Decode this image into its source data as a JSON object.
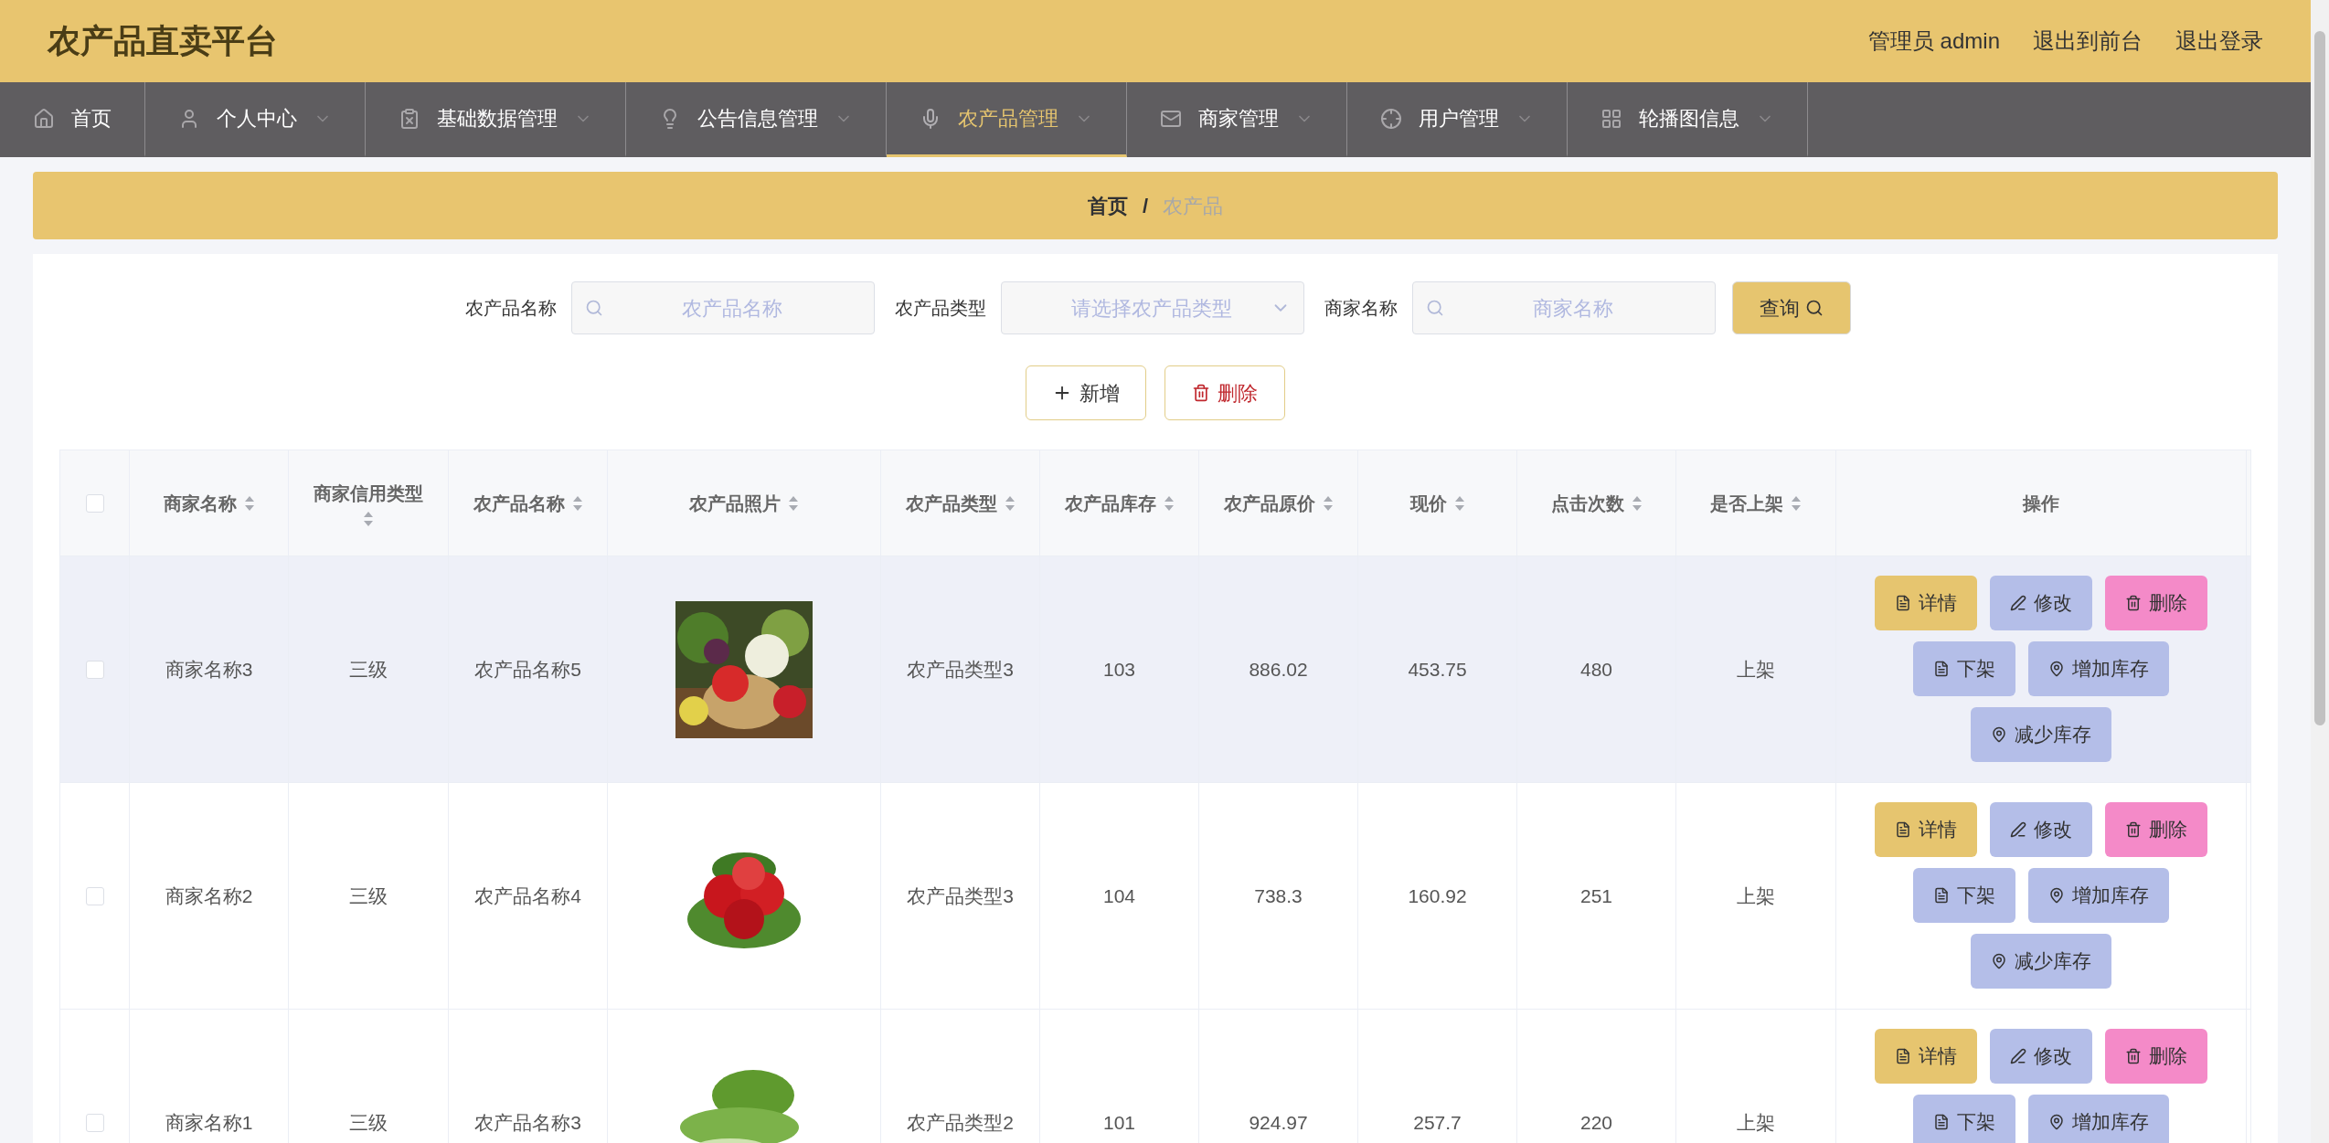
{
  "header": {
    "title": "农产品直卖平台",
    "links": [
      "管理员 admin",
      "退出到前台",
      "退出登录"
    ]
  },
  "nav": [
    {
      "label": "首页",
      "selected": false,
      "has_menu": false
    },
    {
      "label": "个人中心",
      "selected": false,
      "has_menu": true
    },
    {
      "label": "基础数据管理",
      "selected": false,
      "has_menu": true
    },
    {
      "label": "公告信息管理",
      "selected": false,
      "has_menu": true
    },
    {
      "label": "农产品管理",
      "selected": true,
      "has_menu": true
    },
    {
      "label": "商家管理",
      "selected": false,
      "has_menu": true
    },
    {
      "label": "用户管理",
      "selected": false,
      "has_menu": true
    },
    {
      "label": "轮播图信息",
      "selected": false,
      "has_menu": true
    }
  ],
  "breadcrumb": {
    "home": "首页",
    "separator": "/",
    "current": "农产品"
  },
  "filters": [
    {
      "label": "农产品名称",
      "kind": "search",
      "placeholder": "农产品名称"
    },
    {
      "label": "农产品类型",
      "kind": "select",
      "placeholder": "请选择农产品类型"
    },
    {
      "label": "商家名称",
      "kind": "search",
      "placeholder": "商家名称"
    }
  ],
  "query_button": "查询",
  "toolbar": [
    {
      "label": "新增",
      "kind": "add"
    },
    {
      "label": "删除",
      "kind": "delete"
    }
  ],
  "table": {
    "select_all_checked": false,
    "columns": [
      {
        "label": "商家名称",
        "sortable": true
      },
      {
        "label": "商家信用类型",
        "sortable": true
      },
      {
        "label": "农产品名称",
        "sortable": true
      },
      {
        "label": "农产品照片",
        "sortable": true
      },
      {
        "label": "农产品类型",
        "sortable": true
      },
      {
        "label": "农产品库存",
        "sortable": true
      },
      {
        "label": "农产品原价",
        "sortable": true
      },
      {
        "label": "现价",
        "sortable": true
      },
      {
        "label": "点击次数",
        "sortable": true
      },
      {
        "label": "是否上架",
        "sortable": true
      },
      {
        "label": "操作",
        "sortable": false
      }
    ],
    "rows": [
      {
        "checked": false,
        "hovered": true,
        "cells": [
          "商家名称3",
          "三级",
          "农产品名称5",
          "",
          "农产品类型3",
          "103",
          "886.02",
          "453.75",
          "480",
          "上架"
        ],
        "photo": {
          "kind": "picture"
        },
        "actions": [
          {
            "label": "详情",
            "kind": "detail"
          },
          {
            "label": "修改",
            "kind": "edit"
          },
          {
            "label": "删除",
            "kind": "delete"
          },
          {
            "label": "下架",
            "kind": "off"
          },
          {
            "label": "增加库存",
            "kind": "stock"
          },
          {
            "label": "减少库存",
            "kind": "stock"
          }
        ]
      },
      {
        "checked": false,
        "hovered": false,
        "cells": [
          "商家名称2",
          "三级",
          "农产品名称4",
          "",
          "农产品类型3",
          "104",
          "738.3",
          "160.92",
          "251",
          "上架"
        ],
        "photo": {
          "kind": "picture"
        },
        "actions": [
          {
            "label": "详情",
            "kind": "detail"
          },
          {
            "label": "修改",
            "kind": "edit"
          },
          {
            "label": "删除",
            "kind": "delete"
          },
          {
            "label": "下架",
            "kind": "off"
          },
          {
            "label": "增加库存",
            "kind": "stock"
          },
          {
            "label": "减少库存",
            "kind": "stock"
          }
        ]
      },
      {
        "checked": false,
        "hovered": false,
        "cells": [
          "商家名称1",
          "三级",
          "农产品名称3",
          "",
          "农产品类型2",
          "101",
          "924.97",
          "257.7",
          "220",
          "上架"
        ],
        "photo": {
          "kind": "picture"
        },
        "actions": [
          {
            "label": "详情",
            "kind": "detail"
          },
          {
            "label": "修改",
            "kind": "edit"
          },
          {
            "label": "删除",
            "kind": "delete"
          },
          {
            "label": "下架",
            "kind": "off"
          },
          {
            "label": "增加库存",
            "kind": "stock"
          }
        ]
      }
    ]
  }
}
